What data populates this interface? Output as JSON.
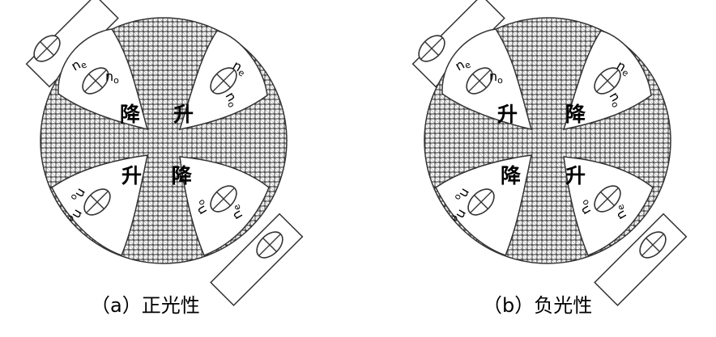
{
  "panels": [
    {
      "id": "a",
      "caption": "（a）正光性",
      "zones": {
        "top_left": "降",
        "top_right": "升",
        "bottom_left": "升",
        "bottom_right": "降"
      }
    },
    {
      "id": "b",
      "caption": "（b）负光性",
      "zones": {
        "top_left": "升",
        "top_right": "降",
        "bottom_left": "降",
        "bottom_right": "升"
      }
    }
  ],
  "ri_labels": {
    "e": "n",
    "e_sub": "e",
    "o": "n",
    "o_sub": "o"
  }
}
